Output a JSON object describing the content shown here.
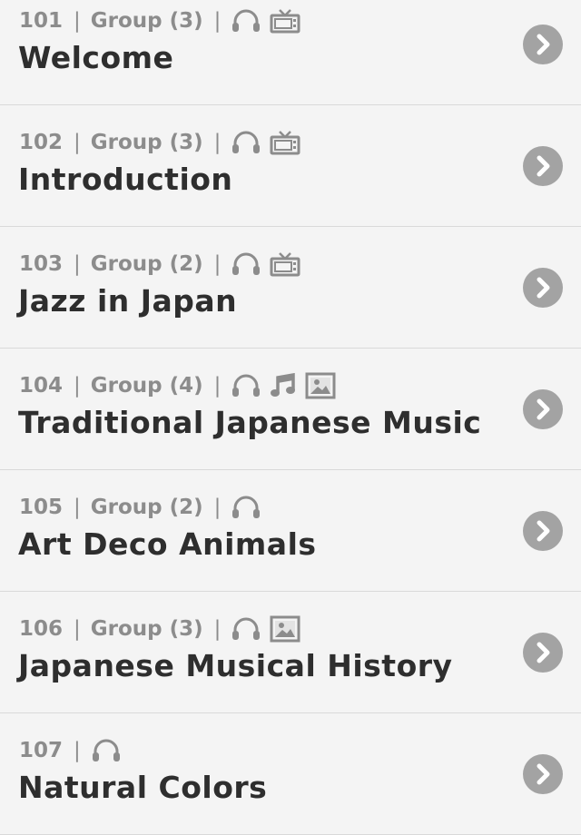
{
  "items": [
    {
      "number": "101",
      "group": "Group (3)",
      "title": "Welcome",
      "icons": [
        "headphones-icon",
        "tv-icon"
      ]
    },
    {
      "number": "102",
      "group": "Group (3)",
      "title": "Introduction",
      "icons": [
        "headphones-icon",
        "tv-icon"
      ]
    },
    {
      "number": "103",
      "group": "Group (2)",
      "title": "Jazz in Japan",
      "icons": [
        "headphones-icon",
        "tv-icon"
      ]
    },
    {
      "number": "104",
      "group": "Group (4)",
      "title": "Traditional Japanese Music",
      "icons": [
        "headphones-icon",
        "music-note-icon",
        "image-icon"
      ]
    },
    {
      "number": "105",
      "group": "Group (2)",
      "title": "Art Deco Animals",
      "icons": [
        "headphones-icon"
      ]
    },
    {
      "number": "106",
      "group": "Group (3)",
      "title": "Japanese Musical History",
      "icons": [
        "headphones-icon",
        "image-icon"
      ]
    },
    {
      "number": "107",
      "group": "",
      "title": "Natural Colors",
      "icons": [
        "headphones-icon"
      ]
    }
  ],
  "separator": "|",
  "colors": {
    "background": "#f4f4f4",
    "divider": "#d9d9d9",
    "meta_text": "#8c8c8c",
    "title_text": "#2e2e2e",
    "chevron_bg": "#a3a3a3"
  }
}
